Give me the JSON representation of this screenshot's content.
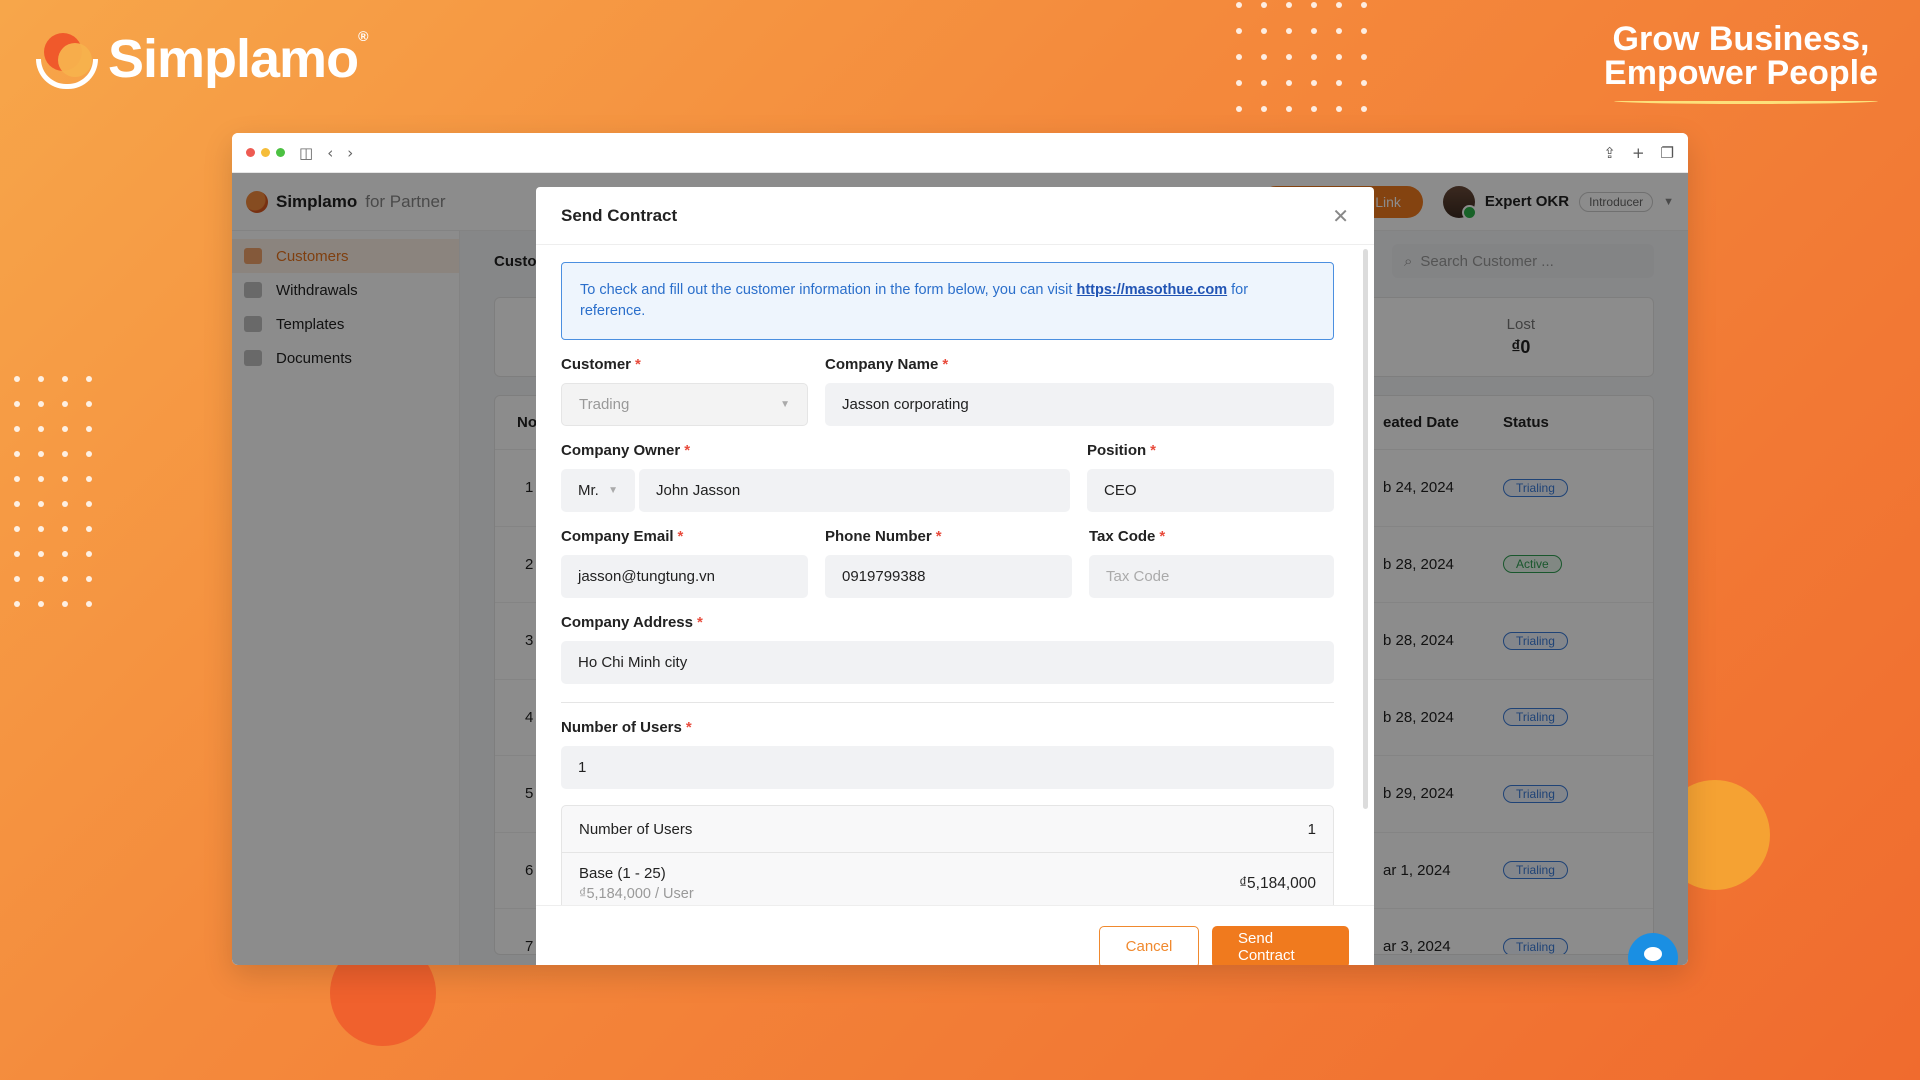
{
  "brand": {
    "name": "Simplamo",
    "registered": "®"
  },
  "tagline": {
    "line1": "Grow Business,",
    "line2": "Empower People"
  },
  "app": {
    "logo_name": "Simplamo",
    "logo_sub": "for Partner",
    "header_button": "Send Contract Link",
    "user_name": "Expert OKR",
    "user_role": "Introducer",
    "sidebar": [
      {
        "label": "Customers",
        "active": true
      },
      {
        "label": "Withdrawals"
      },
      {
        "label": "Templates"
      },
      {
        "label": "Documents"
      }
    ],
    "page_title": "Custo",
    "search_placeholder": "Search Customer ...",
    "stat_lost_label": "Lost",
    "stat_lost_value": "₫0",
    "table": {
      "col_no": "No",
      "col_date": "eated Date",
      "col_status": "Status",
      "rows": [
        {
          "no": "1",
          "date": "b 24, 2024",
          "status": "Trialing"
        },
        {
          "no": "2",
          "date": "b 28, 2024",
          "status": "Active"
        },
        {
          "no": "3",
          "date": "b 28, 2024",
          "status": "Trialing"
        },
        {
          "no": "4",
          "date": "b 28, 2024",
          "status": "Trialing"
        },
        {
          "no": "5",
          "date": "b 29, 2024",
          "status": "Trialing"
        },
        {
          "no": "6",
          "date": "ar 1, 2024",
          "status": "Trialing"
        },
        {
          "no": "7",
          "date": "ar 3, 2024",
          "status": "Trialing"
        }
      ]
    }
  },
  "modal": {
    "title": "Send Contract",
    "notice_prefix": "To check and fill out the customer information in the form below, you can visit ",
    "notice_link": "https://masothue.com",
    "notice_suffix": " for reference.",
    "customer_label": "Customer",
    "customer_value": "Trading",
    "company_name_label": "Company Name",
    "company_name_value": "Jasson corporating",
    "owner_label": "Company Owner",
    "owner_salutation": "Mr.",
    "owner_name": "John Jasson",
    "position_label": "Position",
    "position_value": "CEO",
    "email_label": "Company Email",
    "email_value": "jasson@tungtung.vn",
    "phone_label": "Phone Number",
    "phone_value": "0919799388",
    "tax_label": "Tax Code",
    "tax_placeholder": "Tax Code",
    "address_label": "Company Address",
    "address_value": "Ho Chi Minh city",
    "users_label": "Number of Users",
    "users_value": "1",
    "summary_users_label": "Number of Users",
    "summary_users_value": "1",
    "plan_name": "Base (1 - 25)",
    "plan_price": "₫5,184,000 / User",
    "plan_total": "₫5,184,000",
    "cancel_label": "Cancel",
    "send_label": "Send Contract"
  },
  "colors": {
    "accent": "#f07a1e",
    "link": "#2154b4",
    "required": "#e84b3c"
  }
}
